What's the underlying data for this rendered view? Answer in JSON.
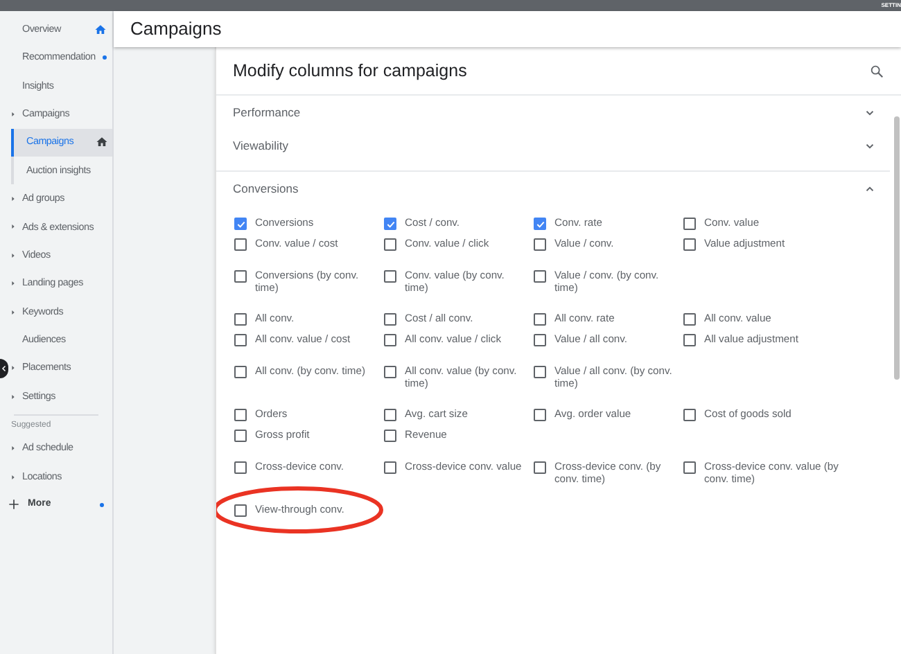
{
  "top_bar": {
    "label": "SETTIN"
  },
  "sidebar": {
    "items": [
      {
        "label": "Overview",
        "expandable": false,
        "is_home": true,
        "has_update": false
      },
      {
        "label": "Recommendation",
        "expandable": false,
        "is_home": false,
        "has_update": true
      },
      {
        "label": "Insights",
        "expandable": false,
        "is_home": false,
        "has_update": false
      },
      {
        "label": "Campaigns",
        "expandable": true,
        "is_home": false,
        "has_update": false,
        "children": [
          {
            "label": "Campaigns",
            "is_home": true,
            "selected": true
          },
          {
            "label": "Auction insights",
            "is_home": false,
            "selected": false
          }
        ]
      },
      {
        "label": "Ad groups",
        "expandable": true,
        "is_home": false,
        "has_update": false
      },
      {
        "label": "Ads & extensions",
        "expandable": true,
        "is_home": false,
        "has_update": false
      },
      {
        "label": "Videos",
        "expandable": true,
        "is_home": false,
        "has_update": false
      },
      {
        "label": "Landing pages",
        "expandable": true,
        "is_home": false,
        "has_update": false
      },
      {
        "label": "Keywords",
        "expandable": true,
        "is_home": false,
        "has_update": false
      },
      {
        "label": "Audiences",
        "expandable": false,
        "is_home": false,
        "has_update": false
      },
      {
        "label": "Placements",
        "expandable": true,
        "is_home": false,
        "has_update": false
      },
      {
        "label": "Settings",
        "expandable": true,
        "is_home": false,
        "has_update": false
      }
    ],
    "suggested_heading": "Suggested",
    "suggested_items": [
      {
        "label": "Ad schedule",
        "expandable": true
      },
      {
        "label": "Locations",
        "expandable": true
      }
    ],
    "more": {
      "label": "More",
      "has_update": true
    }
  },
  "page_title": "Campaigns",
  "dialog": {
    "title": "Modify columns for campaigns",
    "sections": [
      {
        "label": "Performance",
        "expanded": false
      },
      {
        "label": "Viewability",
        "expanded": false
      },
      {
        "label": "Conversions",
        "expanded": true,
        "groups": [
          [
            {
              "label": "Conversions",
              "checked": true
            },
            {
              "label": "Cost / conv.",
              "checked": true
            },
            {
              "label": "Conv. rate",
              "checked": true
            },
            {
              "label": "Conv. value",
              "checked": false
            },
            {
              "label": "Conv. value / cost",
              "checked": false
            },
            {
              "label": "Conv. value / click",
              "checked": false
            },
            {
              "label": "Value / conv.",
              "checked": false
            },
            {
              "label": "Value adjustment",
              "checked": false
            }
          ],
          [
            {
              "label": "Conversions (by conv. time)",
              "checked": false
            },
            {
              "label": "Conv. value (by conv. time)",
              "checked": false
            },
            {
              "label": "Value / conv. (by conv. time)",
              "checked": false
            }
          ],
          [
            {
              "label": "All conv.",
              "checked": false
            },
            {
              "label": "Cost / all conv.",
              "checked": false
            },
            {
              "label": "All conv. rate",
              "checked": false
            },
            {
              "label": "All conv. value",
              "checked": false
            },
            {
              "label": "All conv. value / cost",
              "checked": false
            },
            {
              "label": "All conv. value / click",
              "checked": false
            },
            {
              "label": "Value / all conv.",
              "checked": false
            },
            {
              "label": "All value adjustment",
              "checked": false
            }
          ],
          [
            {
              "label": "All conv. (by conv. time)",
              "checked": false
            },
            {
              "label": "All conv. value (by conv. time)",
              "checked": false
            },
            {
              "label": "Value / all conv. (by conv. time)",
              "checked": false
            }
          ],
          [
            {
              "label": "Orders",
              "checked": false
            },
            {
              "label": "Avg. cart size",
              "checked": false
            },
            {
              "label": "Avg. order value",
              "checked": false
            },
            {
              "label": "Cost of goods sold",
              "checked": false
            },
            {
              "label": "Gross profit",
              "checked": false
            },
            {
              "label": "Revenue",
              "checked": false
            }
          ],
          [
            {
              "label": "Cross-device conv.",
              "checked": false
            },
            {
              "label": "Cross-device conv. value",
              "checked": false
            },
            {
              "label": "Cross-device conv. (by conv. time)",
              "checked": false
            },
            {
              "label": "Cross-device conv. value (by conv. time)",
              "checked": false
            }
          ],
          [
            {
              "label": "View-through conv.",
              "checked": false,
              "highlighted": true
            }
          ]
        ]
      }
    ]
  }
}
